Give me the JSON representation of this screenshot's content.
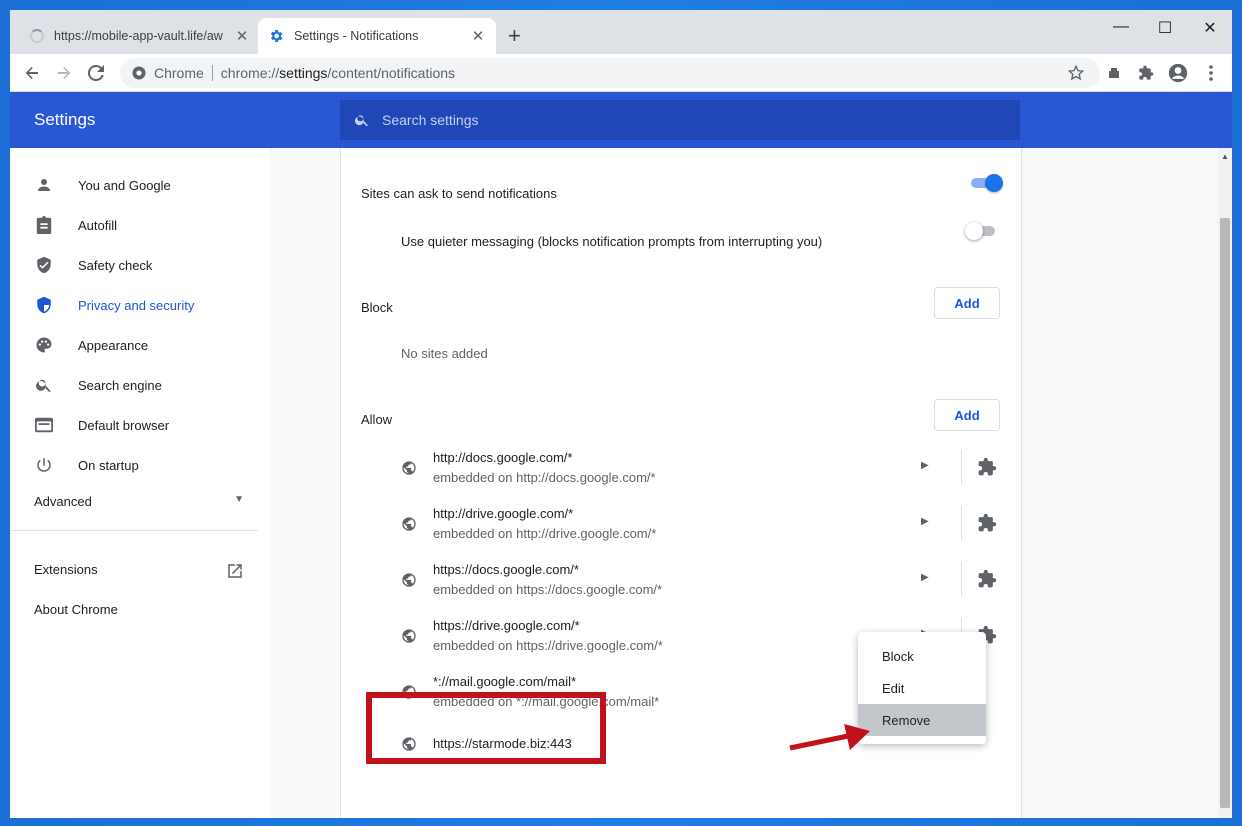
{
  "tabs": [
    {
      "title": "https://mobile-app-vault.life/aw",
      "active": false
    },
    {
      "title": "Settings - Notifications",
      "active": true
    }
  ],
  "window_controls": {
    "minimize": "—",
    "maximize": "☐",
    "close": "✕"
  },
  "omnibox": {
    "chip_label": "Chrome",
    "url_prefix": "chrome://",
    "url_bold": "settings",
    "url_rest": "/content/notifications"
  },
  "header": {
    "title": "Settings",
    "search_placeholder": "Search settings"
  },
  "sidebar": {
    "items": [
      {
        "label": "You and Google",
        "icon": "person-icon"
      },
      {
        "label": "Autofill",
        "icon": "clipboard-icon"
      },
      {
        "label": "Safety check",
        "icon": "shield-check-icon"
      },
      {
        "label": "Privacy and security",
        "icon": "shield-icon",
        "active": true
      },
      {
        "label": "Appearance",
        "icon": "palette-icon"
      },
      {
        "label": "Search engine",
        "icon": "search-icon"
      },
      {
        "label": "Default browser",
        "icon": "browser-icon"
      },
      {
        "label": "On startup",
        "icon": "power-icon"
      }
    ],
    "advanced_label": "Advanced",
    "extensions_label": "Extensions",
    "about_label": "About Chrome"
  },
  "main": {
    "sites_can_ask": "Sites can ask to send notifications",
    "quieter_messaging": "Use quieter messaging (blocks notification prompts from interrupting you)",
    "block_label": "Block",
    "block_add": "Add",
    "no_sites": "No sites added",
    "allow_label": "Allow",
    "allow_add": "Add",
    "allow_sites": [
      {
        "url": "http://docs.google.com/*",
        "sub": "embedded on http://docs.google.com/*"
      },
      {
        "url": "http://drive.google.com/*",
        "sub": "embedded on http://drive.google.com/*"
      },
      {
        "url": "https://docs.google.com/*",
        "sub": "embedded on https://docs.google.com/*"
      },
      {
        "url": "https://drive.google.com/*",
        "sub": "embedded on https://drive.google.com/*"
      },
      {
        "url": "*://mail.google.com/mail*",
        "sub": "embedded on *://mail.google.com/mail*"
      },
      {
        "url": "https://starmode.biz:443",
        "sub": ""
      }
    ]
  },
  "context_menu": {
    "items": [
      "Block",
      "Edit",
      "Remove"
    ]
  },
  "colors": {
    "accent": "#1a56d6",
    "header": "#2a58d4",
    "highlight": "#c2111b"
  }
}
